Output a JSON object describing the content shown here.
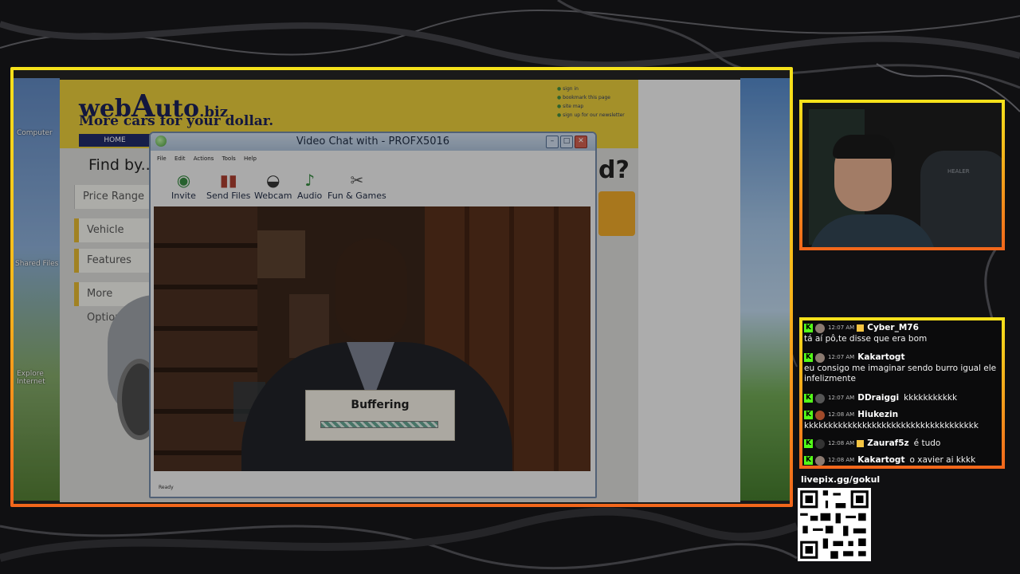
{
  "website": {
    "logo_prefix": "web",
    "logo_big": "A",
    "logo_mid": "uto",
    "logo_suffix": ".biz",
    "tagline": "More cars for your dollar.",
    "header_links": [
      "sign in",
      "bookmark this page",
      "site map",
      "sign up for our newsletter"
    ],
    "nav_home": "HOME",
    "find_by": "Find by...",
    "side_buttons": [
      "Price Range",
      "Vehicle Type",
      "Features",
      "More Options"
    ],
    "right_fragment": "d?"
  },
  "desktop_icons": [
    "Computer",
    "Shared Files",
    "Explore Internet"
  ],
  "video_chat": {
    "title": "Video Chat with  -  PROFX5016",
    "menu": [
      "File",
      "Edit",
      "Actions",
      "Tools",
      "Help"
    ],
    "toolbar": [
      {
        "label": "Invite",
        "icon": "globe-icon"
      },
      {
        "label": "Send Files",
        "icon": "books-icon"
      },
      {
        "label": "Webcam",
        "icon": "webcam-icon"
      },
      {
        "label": "Audio",
        "icon": "music-note-icon"
      },
      {
        "label": "Fun & Games",
        "icon": "scissors-icon"
      }
    ],
    "buffering_label": "Buffering",
    "status": "Ready"
  },
  "chat": {
    "messages": [
      {
        "time": "12:07 AM",
        "user": "Cyber_M76",
        "text": "tá aí pô,te disse que era bom",
        "inline": false
      },
      {
        "time": "12:07 AM",
        "user": "Kakartogt",
        "text": "eu consigo me imaginar sendo burro igual ele infelizmente",
        "inline": false
      },
      {
        "time": "12:07 AM",
        "user": "DDraiggi",
        "text": "kkkkkkkkkkk",
        "inline": true
      },
      {
        "time": "12:08 AM",
        "user": "Hiukezin",
        "text": "kkkkkkkkkkkkkkkkkkkkkkkkkkkkkkkkkkkk",
        "inline": false
      },
      {
        "time": "12:08 AM",
        "user": "Zauraf5z",
        "text": "é tudo",
        "inline": true
      },
      {
        "time": "12:08 AM",
        "user": "Kakartogt",
        "text": "o xavier ai kkkk",
        "inline": true
      }
    ]
  },
  "livepix": {
    "label": "livepix.gg/gokul"
  },
  "webcam": {
    "chair_brand": "HEALER"
  },
  "colors": {
    "frame_top": "#f6e21b",
    "frame_bottom": "#f2661b",
    "kick_green": "#53fc18"
  }
}
